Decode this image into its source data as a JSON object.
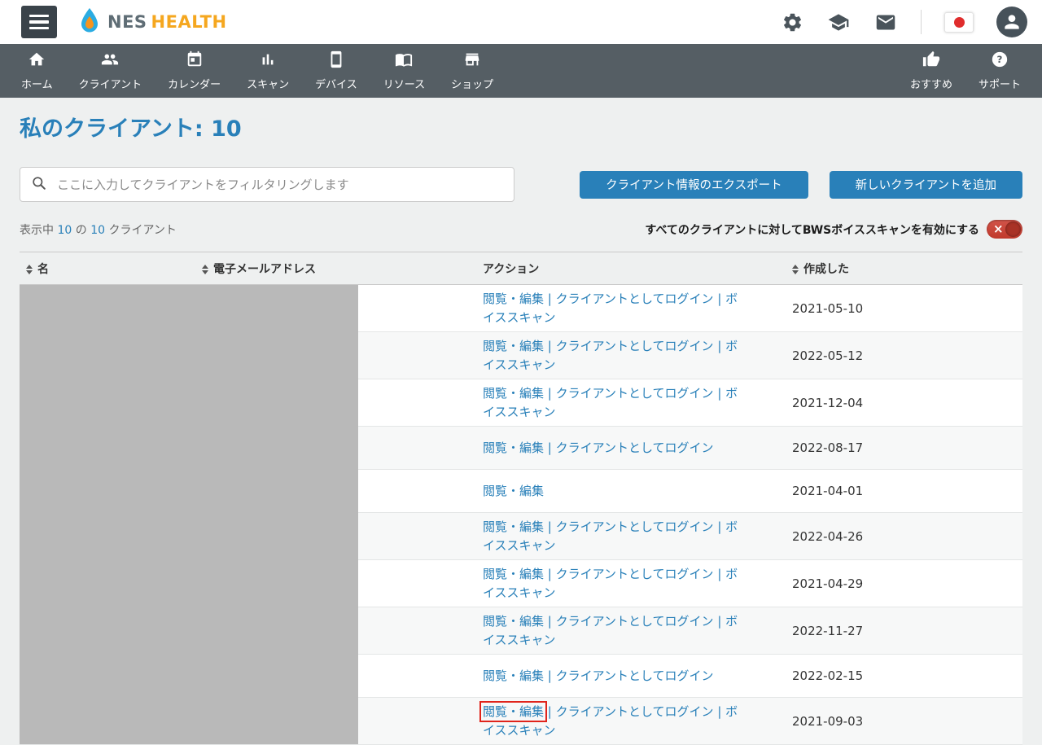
{
  "topbar": {
    "brand": {
      "name_primary": "NES",
      "name_secondary": "HEALTH",
      "logo_icon": "water-drop-flame-icon"
    },
    "icons": [
      "hamburger-menu-icon",
      "gear-icon",
      "graduation-cap-icon",
      "mail-icon",
      "japan-flag-icon",
      "avatar-icon"
    ]
  },
  "nav": {
    "items": [
      {
        "label": "ホーム",
        "icon": "home-icon"
      },
      {
        "label": "クライアント",
        "icon": "people-icon"
      },
      {
        "label": "カレンダー",
        "icon": "calendar-icon"
      },
      {
        "label": "スキャン",
        "icon": "bar-chart-icon"
      },
      {
        "label": "デバイス",
        "icon": "mobile-device-icon"
      },
      {
        "label": "リソース",
        "icon": "book-icon"
      },
      {
        "label": "ショップ",
        "icon": "storefront-icon"
      }
    ],
    "right_items": [
      {
        "label": "おすすめ",
        "icon": "thumb-up-icon"
      },
      {
        "label": "サポート",
        "icon": "question-mark-icon"
      }
    ]
  },
  "page": {
    "title": "私のクライアント: 10",
    "search_placeholder": "ここに入力してクライアントをフィルタリングします",
    "export_button": "クライアント情報のエクスポート",
    "add_button": "新しいクライアントを追加",
    "showing": {
      "prefix": "表示中 ",
      "shown": "10",
      "of": " の ",
      "total": "10",
      "suffix": " クライアント"
    },
    "bws_toggle_label": "すべてのクライアントに対してBWSボイススキャンを有効にする",
    "bws_toggle_state": "off"
  },
  "table": {
    "headers": [
      {
        "label": "名",
        "sortable": true
      },
      {
        "label": "電子メールアドレス",
        "sortable": true
      },
      {
        "label": "アクション",
        "sortable": false
      },
      {
        "label": "作成した",
        "sortable": true
      }
    ],
    "action_separator": "|",
    "rows": [
      {
        "actions": [
          "閲覧・編集",
          "クライアントとしてログイン",
          "ボイススキャン"
        ],
        "created": "2021-05-10"
      },
      {
        "actions": [
          "閲覧・編集",
          "クライアントとしてログイン",
          "ボイススキャン"
        ],
        "created": "2022-05-12"
      },
      {
        "actions": [
          "閲覧・編集",
          "クライアントとしてログイン",
          "ボイススキャン"
        ],
        "created": "2021-12-04"
      },
      {
        "actions": [
          "閲覧・編集",
          "クライアントとしてログイン"
        ],
        "created": "2022-08-17"
      },
      {
        "actions": [
          "閲覧・編集"
        ],
        "created": "2021-04-01"
      },
      {
        "actions": [
          "閲覧・編集",
          "クライアントとしてログイン",
          "ボイススキャン"
        ],
        "created": "2022-04-26"
      },
      {
        "actions": [
          "閲覧・編集",
          "クライアントとしてログイン",
          "ボイススキャン"
        ],
        "created": "2021-04-29"
      },
      {
        "actions": [
          "閲覧・編集",
          "クライアントとしてログイン",
          "ボイススキャン"
        ],
        "created": "2022-11-27"
      },
      {
        "actions": [
          "閲覧・編集",
          "クライアントとしてログイン"
        ],
        "created": "2022-02-15"
      },
      {
        "actions": [
          "閲覧・編集",
          "クライアントとしてログイン",
          "ボイススキャン"
        ],
        "created": "2021-09-03",
        "highlight_action_index": 0
      }
    ]
  },
  "colors": {
    "accent_blue": "#2980b9",
    "nav_background": "#555e64",
    "hamburger_background": "#3a434a",
    "brand_orange": "#f5a71f",
    "brand_gray": "#5f6d75",
    "toggle_red": "#c0392b",
    "redaction_gray": "#b9b9b9",
    "annotation_red": "#e0241b",
    "page_background": "#eef0f0"
  }
}
